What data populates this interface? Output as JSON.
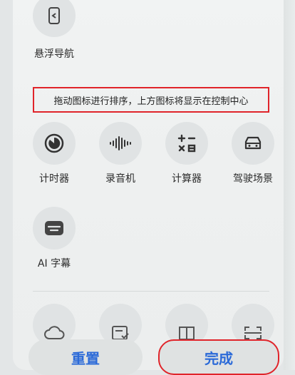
{
  "top_item": {
    "label": "悬浮导航",
    "icon": "floating-nav-icon"
  },
  "hint": "拖动图标进行排序，上方图标将显示在控制中心",
  "tiles": [
    {
      "label": "计时器",
      "icon": "timer-icon"
    },
    {
      "label": "录音机",
      "icon": "recorder-icon"
    },
    {
      "label": "计算器",
      "icon": "calculator-icon"
    },
    {
      "label": "驾驶场景",
      "icon": "car-icon"
    },
    {
      "label": "AI 字幕",
      "icon": "ai-subtitle-icon"
    }
  ],
  "lower_tiles": [
    {
      "icon": "cloud-icon"
    },
    {
      "icon": "document-check-icon"
    },
    {
      "icon": "book-icon"
    },
    {
      "icon": "scan-icon"
    }
  ],
  "buttons": {
    "reset": "重置",
    "done": "完成"
  },
  "colors": {
    "accent": "#2b6ad8",
    "highlight": "#e0242a"
  }
}
